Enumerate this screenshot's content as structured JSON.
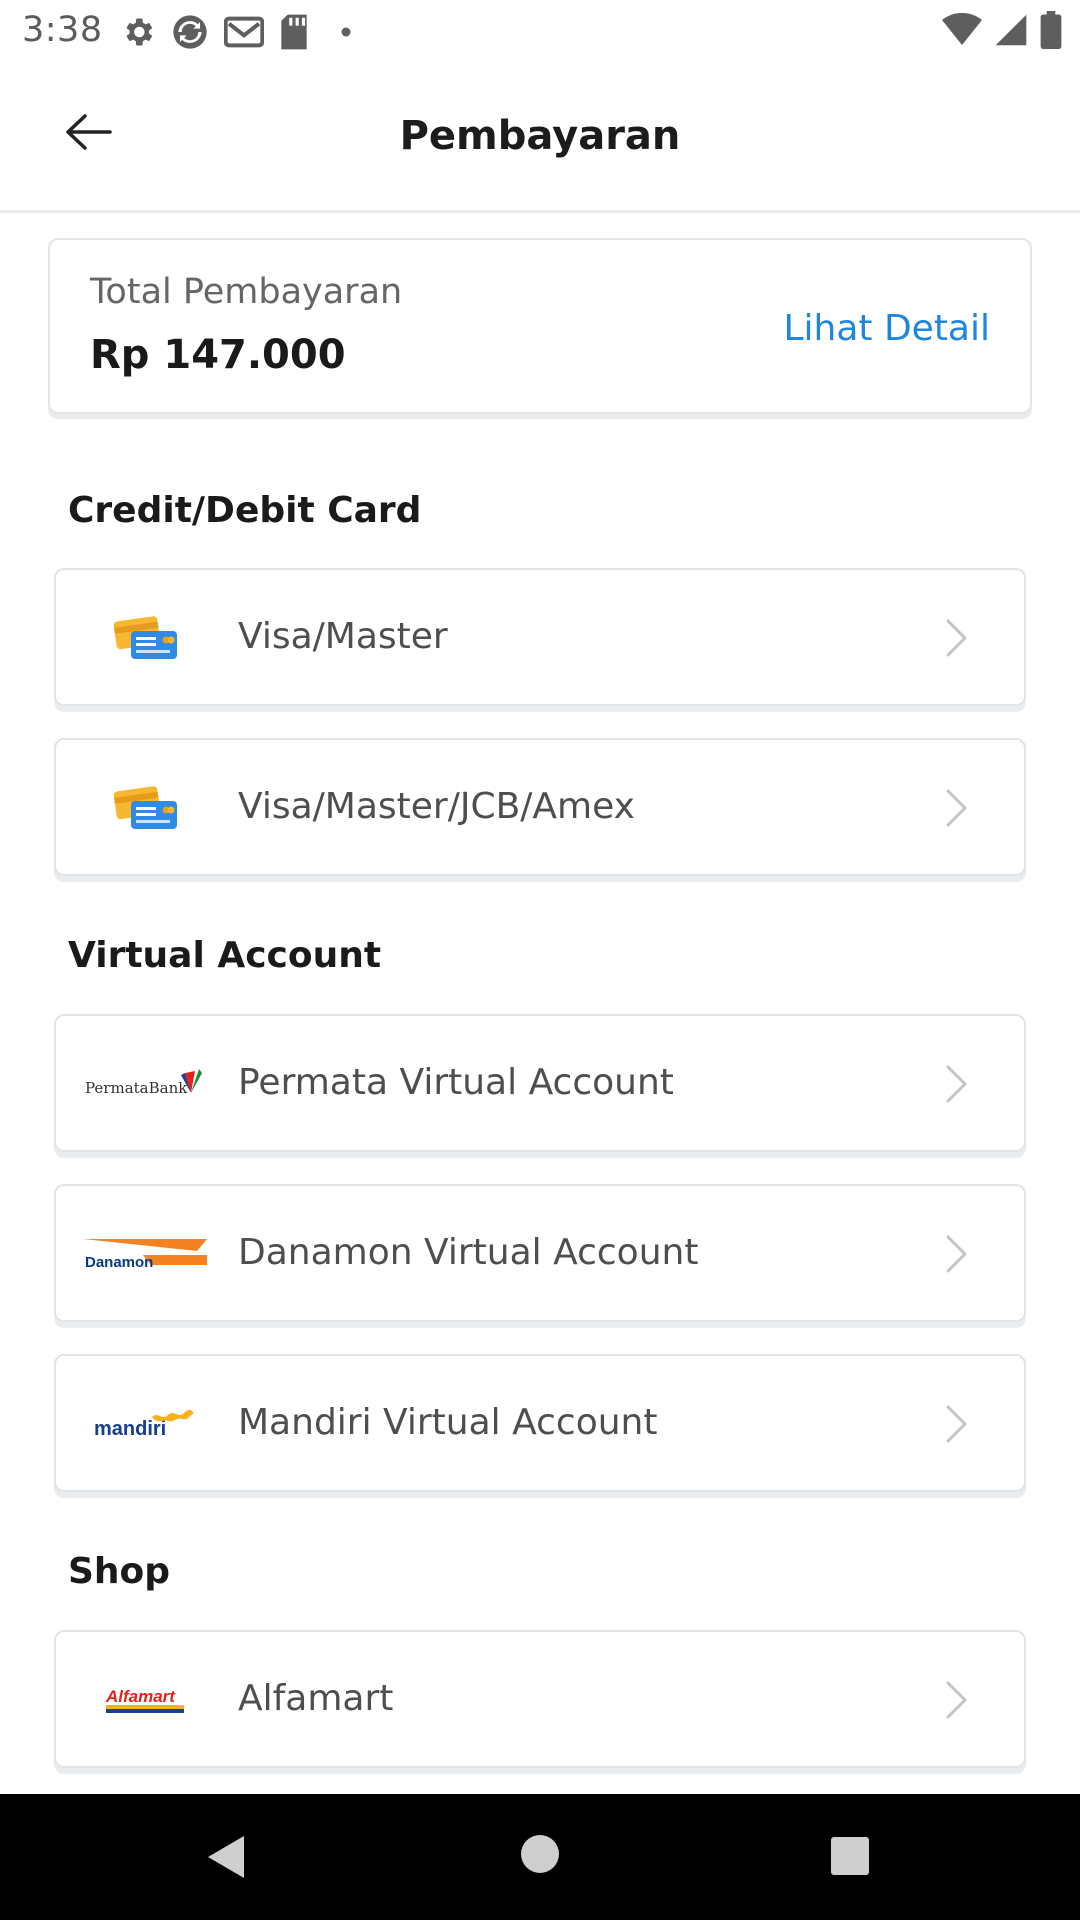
{
  "status_bar": {
    "time": "3:38",
    "left_icons": [
      "gear-icon",
      "sync-icon",
      "gmail-icon",
      "sd-card-icon",
      "dot-icon"
    ],
    "right_icons": [
      "wifi-icon",
      "signal-icon",
      "battery-icon"
    ]
  },
  "app_bar": {
    "title": "Pembayaran",
    "back_icon": "arrow-left-icon"
  },
  "total": {
    "label": "Total Pembayaran",
    "amount": "Rp 147.000",
    "detail_link": "Lihat Detail"
  },
  "sections": [
    {
      "title": "Credit/Debit Card",
      "options": [
        {
          "label": "Visa/Master",
          "logo": "credit-card-icon"
        },
        {
          "label": "Visa/Master/JCB/Amex",
          "logo": "credit-card-icon"
        }
      ]
    },
    {
      "title": "Virtual Account",
      "options": [
        {
          "label": "Permata Virtual Account",
          "logo_text": "PermataBank"
        },
        {
          "label": "Danamon Virtual Account",
          "logo_text": "Danamon"
        },
        {
          "label": "Mandiri Virtual Account",
          "logo_text": "mandiri"
        }
      ]
    },
    {
      "title": "Shop",
      "options": [
        {
          "label": "Alfamart",
          "logo_text": "Alfamart"
        }
      ]
    }
  ],
  "colors": {
    "accent": "#1f86e0",
    "card_yellow": "#f7b731",
    "card_blue": "#2f8be6",
    "danamon_orange": "#f58220",
    "danamon_navy": "#0a3a7d",
    "mandiri_navy": "#153e8f",
    "mandiri_gold": "#f9b21c",
    "alfamart_red": "#e2231a",
    "alfamart_blue": "#1c3f94"
  }
}
